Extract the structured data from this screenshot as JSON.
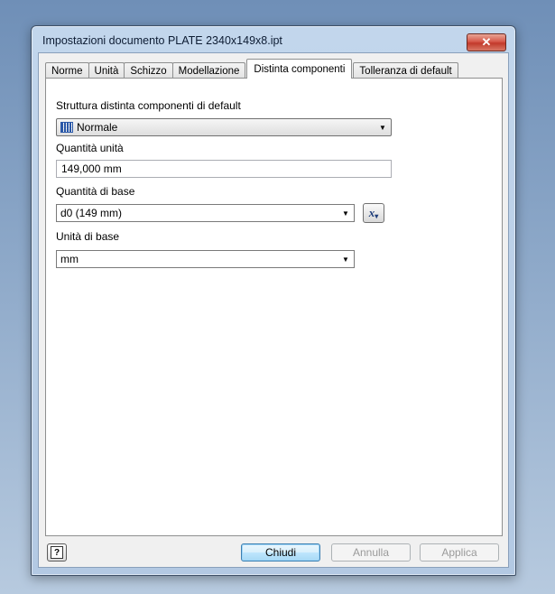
{
  "window": {
    "title": "Impostazioni documento PLATE 2340x149x8.ipt",
    "close_label": "✕"
  },
  "tabs": [
    {
      "label": "Norme"
    },
    {
      "label": "Unità"
    },
    {
      "label": "Schizzo"
    },
    {
      "label": "Modellazione"
    },
    {
      "label": "Distinta componenti",
      "active": true
    },
    {
      "label": "Tolleranza di default"
    }
  ],
  "bom": {
    "structure_label": "Struttura distinta componenti di default",
    "structure_value": "Normale",
    "structure_icon": "grid-icon",
    "unit_qty_label": "Quantità unità",
    "unit_qty_value": "149,000 mm",
    "base_qty_label": "Quantità di base",
    "base_qty_value": "d0 (149 mm)",
    "fx_label": "x",
    "base_unit_label": "Unità di base",
    "base_unit_value": "mm"
  },
  "footer": {
    "help_glyph": "?",
    "close_button": "Chiudi",
    "cancel_button": "Annulla",
    "apply_button": "Applica"
  }
}
